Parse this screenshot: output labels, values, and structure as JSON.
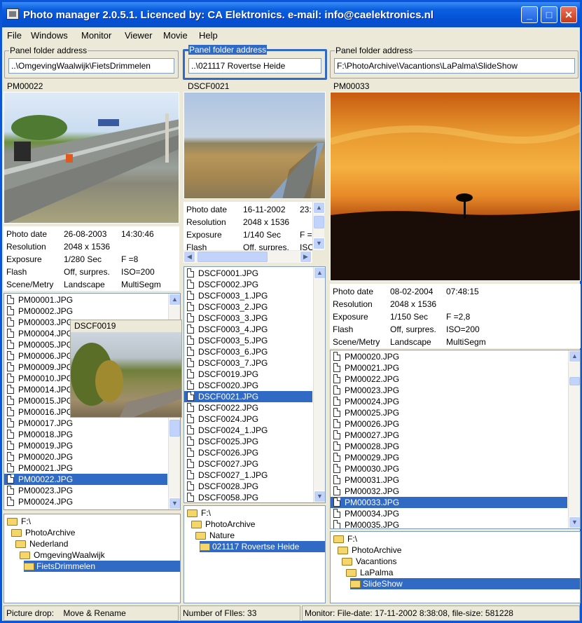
{
  "window": {
    "title": "Photo manager  2.0.5.1. Licenced by: CA Elektronics. e-mail: info@caelektronics.nl"
  },
  "menu": [
    "File",
    "Windows",
    "Monitor",
    "Viewer",
    "Movie",
    "Help"
  ],
  "panels": [
    {
      "folder_label": "Panel folder address",
      "folder_value": "..\\OmgevingWaalwijk\\FietsDrimmelen",
      "photo_caption": "PM00022",
      "info": [
        [
          "Photo date",
          "26-08-2003",
          "14:30:46"
        ],
        [
          "Resolution",
          "2048 x 1536",
          ""
        ],
        [
          "Exposure",
          "1/280 Sec",
          "F =8"
        ],
        [
          "Flash",
          "Off, surpres.",
          "ISO=200"
        ],
        [
          "Scene/Metry",
          "Landscape",
          "MultiSegm"
        ]
      ],
      "files": [
        "PM00001.JPG",
        "PM00002.JPG",
        "PM00003.JPG",
        "PM00004.JPG",
        "PM00005.JPG",
        "PM00006.JPG",
        "PM00009.JPG",
        "PM00010.JPG",
        "PM00014.JPG",
        "PM00015.JPG",
        "PM00016.JPG",
        "PM00017.JPG",
        "PM00018.JPG",
        "PM00019.JPG",
        "PM00020.JPG",
        "PM00021.JPG",
        "PM00022.JPG",
        "PM00023.JPG",
        "PM00024.JPG"
      ],
      "selected_file": "PM00022.JPG",
      "tree": [
        "F:\\",
        "PhotoArchive",
        "Nederland",
        "OmgevingWaalwijk",
        "FietsDrimmelen"
      ],
      "selected_folder": "FietsDrimmelen"
    },
    {
      "folder_label": "Panel folder address",
      "folder_value": "..\\021117 Rovertse Heide",
      "photo_caption": "DSCF0021",
      "info": [
        [
          "Photo date",
          "16-11-2002",
          "23:"
        ],
        [
          "Resolution",
          "2048 x 1536",
          ""
        ],
        [
          "Exposure",
          "1/140 Sec",
          "F ="
        ],
        [
          "Flash",
          "Off, surpres.",
          "ISO"
        ]
      ],
      "files": [
        "DSCF0001.JPG",
        "DSCF0002.JPG",
        "DSCF0003_1.JPG",
        "DSCF0003_2.JPG",
        "DSCF0003_3.JPG",
        "DSCF0003_4.JPG",
        "DSCF0003_5.JPG",
        "DSCF0003_6.JPG",
        "DSCF0003_7.JPG",
        "DSCF0019.JPG",
        "DSCF0020.JPG",
        "DSCF0021.JPG",
        "DSCF0022.JPG",
        "DSCF0024.JPG",
        "DSCF0024_1.JPG",
        "DSCF0025.JPG",
        "DSCF0026.JPG",
        "DSCF0027.JPG",
        "DSCF0027_1.JPG",
        "DSCF0028.JPG",
        "DSCF0058.JPG"
      ],
      "selected_file": "DSCF0021.JPG",
      "tree": [
        "F:\\",
        "PhotoArchive",
        "Nature",
        "021117 Rovertse Heide"
      ],
      "selected_folder": "021117 Rovertse Heide"
    },
    {
      "folder_label": "Panel folder address",
      "folder_value": "F:\\PhotoArchive\\Vacantions\\LaPalma\\SlideShow",
      "photo_caption": "PM00033",
      "info": [
        [
          "Photo date",
          "08-02-2004",
          "07:48:15"
        ],
        [
          "Resolution",
          "2048 x 1536",
          ""
        ],
        [
          "Exposure",
          "1/150 Sec",
          "F =2,8"
        ],
        [
          "Flash",
          "Off, surpres.",
          "ISO=200"
        ],
        [
          "Scene/Metry",
          "Landscape",
          "MultiSegm"
        ]
      ],
      "files": [
        "PM00020.JPG",
        "PM00021.JPG",
        "PM00022.JPG",
        "PM00023.JPG",
        "PM00024.JPG",
        "PM00025.JPG",
        "PM00026.JPG",
        "PM00027.JPG",
        "PM00028.JPG",
        "PM00029.JPG",
        "PM00030.JPG",
        "PM00031.JPG",
        "PM00032.JPG",
        "PM00033.JPG",
        "PM00034.JPG",
        "PM00035.JPG"
      ],
      "selected_file": "PM00033.JPG",
      "tree": [
        "F:\\",
        "PhotoArchive",
        "Vacantions",
        "LaPalma",
        "SlideShow"
      ],
      "selected_folder": "SlideShow"
    }
  ],
  "floating_preview": {
    "caption": "DSCF0019"
  },
  "status": {
    "drop_label": "Picture drop:",
    "drop_value": "Move & Rename",
    "count": "Number of FIles: 33",
    "monitor": "Monitor: File-date: 17-11-2002 8:38:08, file-size: 581228"
  },
  "colors": {
    "title_bar": "#0a5ee0",
    "selection": "#316ac5",
    "window_bg": "#ece9d8"
  }
}
